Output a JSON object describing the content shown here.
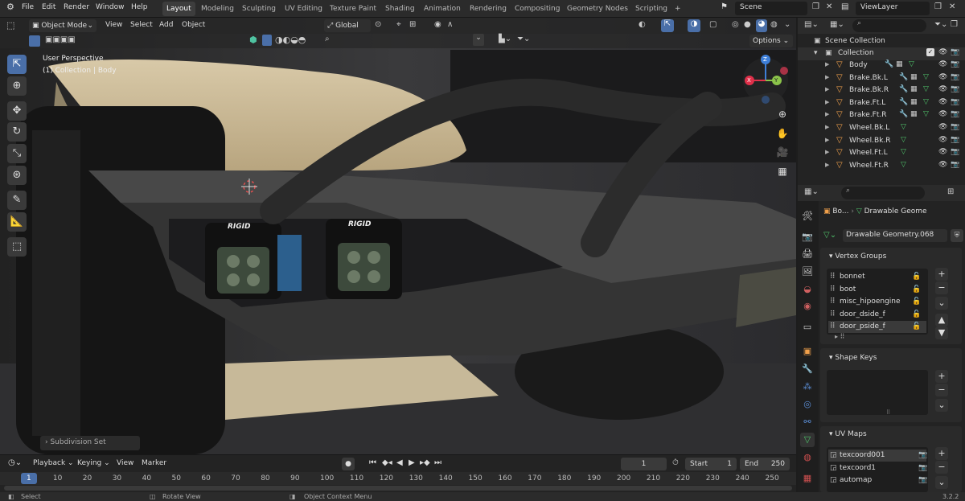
{
  "topbar": {
    "menus": [
      "File",
      "Edit",
      "Render",
      "Window",
      "Help"
    ],
    "workspaces": [
      "Layout",
      "Modeling",
      "Sculpting",
      "UV Editing",
      "Texture Paint",
      "Shading",
      "Animation",
      "Rendering",
      "Compositing",
      "Geometry Nodes",
      "Scripting"
    ],
    "add_tab": "+",
    "scene": "Scene",
    "view_layer": "ViewLayer"
  },
  "viewport": {
    "mode": "Object Mode",
    "menus": [
      "View",
      "Select",
      "Add",
      "Object"
    ],
    "transform": "Global",
    "options": "Options",
    "overlay_line1": "User Perspective",
    "overlay_line2": "(1) Collection | Body",
    "last_op": "Subdivision Set",
    "gizmo": {
      "z": "Z",
      "y": "Y",
      "x": "X"
    },
    "brand1": "RIGID",
    "brand2": "RIGID"
  },
  "outliner": {
    "root": "Scene Collection",
    "collection": "Collection",
    "objects": [
      "Body",
      "Brake.Bk.L",
      "Brake.Bk.R",
      "Brake.Ft.L",
      "Brake.Ft.R",
      "Wheel.Bk.L",
      "Wheel.Bk.R",
      "Wheel.Ft.L",
      "Wheel.Ft.R"
    ]
  },
  "properties": {
    "breadcrumb_obj": "Bo...",
    "breadcrumb_data": "Drawable Geome",
    "datablock": "Drawable Geometry.068",
    "vertex_groups_title": "Vertex Groups",
    "vertex_groups": [
      "bonnet",
      "boot",
      "misc_hipoengine",
      "door_dside_f",
      "door_pside_f"
    ],
    "shape_keys_title": "Shape Keys",
    "uv_maps_title": "UV Maps",
    "uv_maps": [
      "texcoord001",
      "texcoord1",
      "automap"
    ]
  },
  "timeline": {
    "menus": [
      "Playback",
      "Keying",
      "View",
      "Marker"
    ],
    "current_frame": "1",
    "start_label": "Start",
    "start": "1",
    "end_label": "End",
    "end": "250",
    "ticks": [
      "1",
      "10",
      "20",
      "30",
      "40",
      "50",
      "60",
      "70",
      "80",
      "90",
      "100",
      "110",
      "120",
      "130",
      "140",
      "150",
      "160",
      "170",
      "180",
      "190",
      "200",
      "210",
      "220",
      "230",
      "240",
      "250"
    ]
  },
  "statusbar": {
    "select": "Select",
    "rotate": "Rotate View",
    "context": "Object Context Menu",
    "version": "3.2.2"
  },
  "colors": {
    "accent": "#4a6fa8",
    "x_axis": "#e0304a",
    "y_axis": "#8bc34a",
    "z_axis": "#3e7fd8",
    "mesh_icon": "#f0a04b",
    "vgroup_row": "#3a3a3a"
  }
}
